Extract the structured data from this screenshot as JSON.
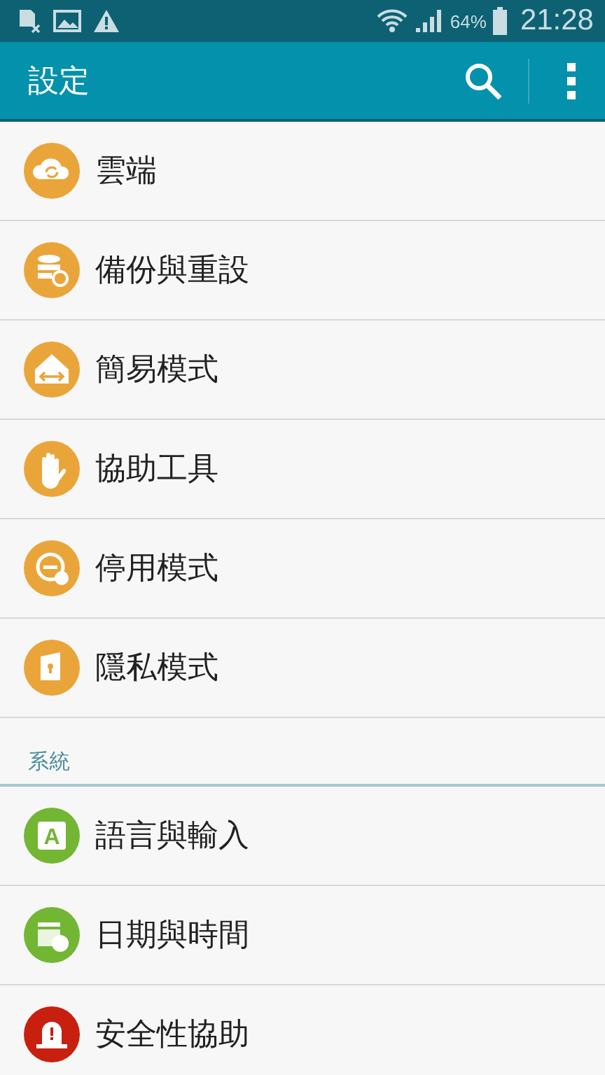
{
  "status_bar": {
    "battery": "64%",
    "time": "21:28"
  },
  "app_bar": {
    "title": "設定"
  },
  "sections": [
    {
      "items": [
        {
          "label": "雲端",
          "kind": "cloud",
          "color": "#eaa53a"
        },
        {
          "label": "備份與重設",
          "kind": "backup",
          "color": "#eaa53a"
        },
        {
          "label": "簡易模式",
          "kind": "home",
          "color": "#eaa53a"
        },
        {
          "label": "協助工具",
          "kind": "hand",
          "color": "#eaa53a"
        },
        {
          "label": "停用模式",
          "kind": "block",
          "color": "#eaa53a"
        },
        {
          "label": "隱私模式",
          "kind": "private",
          "color": "#eaa53a"
        }
      ]
    },
    {
      "header": "系統",
      "items": [
        {
          "label": "語言與輸入",
          "kind": "letter",
          "letter": "A",
          "color": "#73b634"
        },
        {
          "label": "日期與時間",
          "kind": "calendar",
          "color": "#73b634"
        },
        {
          "label": "安全性協助",
          "kind": "alert",
          "color": "#c8200e"
        }
      ]
    }
  ]
}
